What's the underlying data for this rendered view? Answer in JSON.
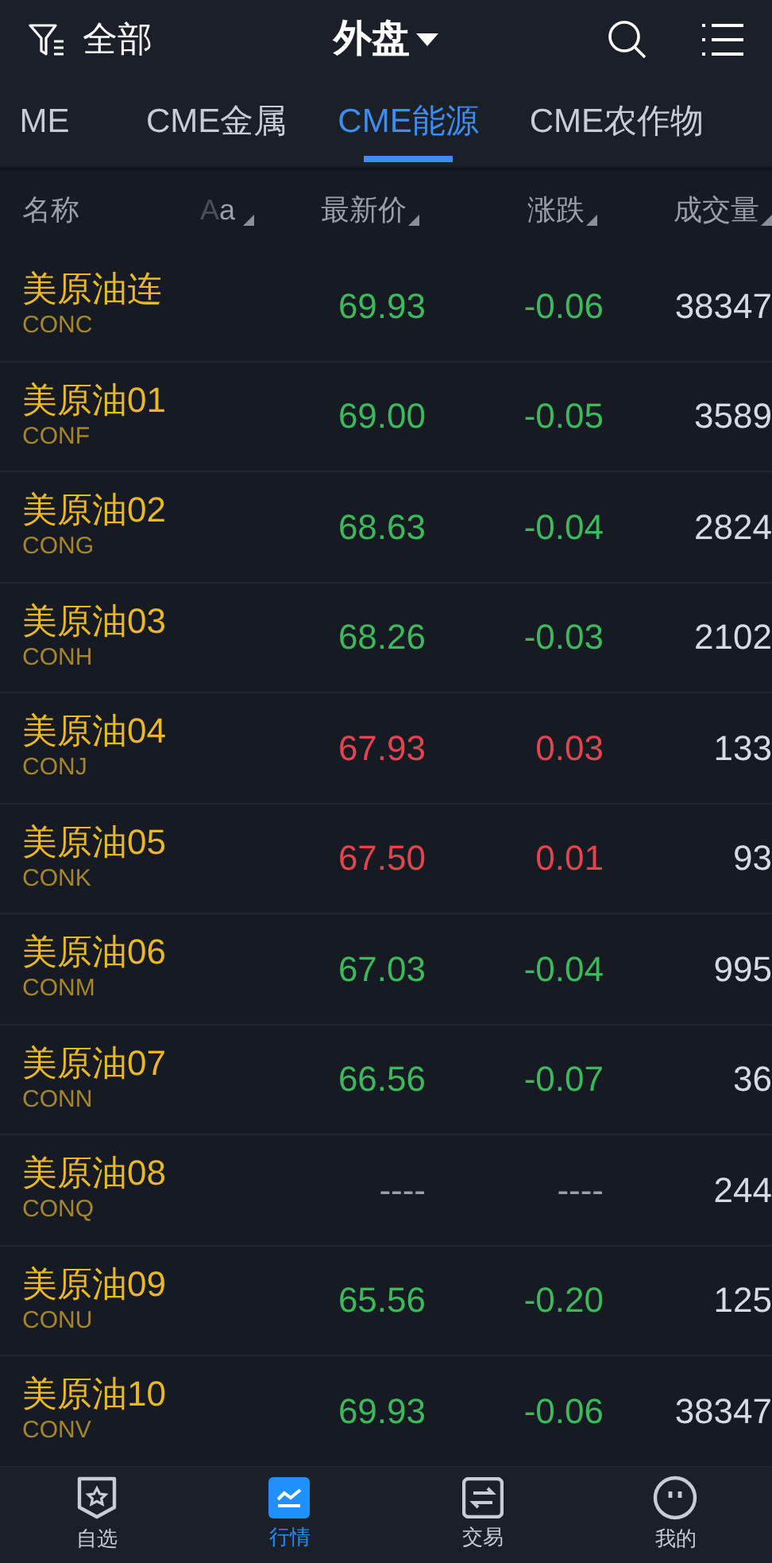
{
  "top_bar": {
    "filter_label": "全部",
    "title": "外盘"
  },
  "tabs": [
    {
      "label": "ME",
      "selected": false
    },
    {
      "label": "CME金属",
      "selected": false
    },
    {
      "label": "CME能源",
      "selected": true
    },
    {
      "label": "CME农作物",
      "selected": false
    }
  ],
  "columns": {
    "name": "名称",
    "font_toggle": "Aa",
    "price": "最新价",
    "change": "涨跌",
    "volume": "成交量"
  },
  "rows": [
    {
      "name": "美原油连",
      "code": "CONC",
      "price": "69.93",
      "change": "-0.06",
      "volume": "38347",
      "kind": "down"
    },
    {
      "name": "美原油01",
      "code": "CONF",
      "price": "69.00",
      "change": "-0.05",
      "volume": "3589",
      "kind": "down"
    },
    {
      "name": "美原油02",
      "code": "CONG",
      "price": "68.63",
      "change": "-0.04",
      "volume": "2824",
      "kind": "down"
    },
    {
      "name": "美原油03",
      "code": "CONH",
      "price": "68.26",
      "change": "-0.03",
      "volume": "2102",
      "kind": "down"
    },
    {
      "name": "美原油04",
      "code": "CONJ",
      "price": "67.93",
      "change": "0.03",
      "volume": "133",
      "kind": "up"
    },
    {
      "name": "美原油05",
      "code": "CONK",
      "price": "67.50",
      "change": "0.01",
      "volume": "93",
      "kind": "up"
    },
    {
      "name": "美原油06",
      "code": "CONM",
      "price": "67.03",
      "change": "-0.04",
      "volume": "995",
      "kind": "down"
    },
    {
      "name": "美原油07",
      "code": "CONN",
      "price": "66.56",
      "change": "-0.07",
      "volume": "36",
      "kind": "down"
    },
    {
      "name": "美原油08",
      "code": "CONQ",
      "price": "----",
      "change": "----",
      "volume": "244",
      "kind": "none"
    },
    {
      "name": "美原油09",
      "code": "CONU",
      "price": "65.56",
      "change": "-0.20",
      "volume": "125",
      "kind": "down"
    },
    {
      "name": "美原油10",
      "code": "CONV",
      "price": "69.93",
      "change": "-0.06",
      "volume": "38347",
      "kind": "down"
    }
  ],
  "bottom_nav": [
    {
      "label": "自选",
      "selected": false,
      "kind": "watchlist"
    },
    {
      "label": "行情",
      "selected": true,
      "kind": "market"
    },
    {
      "label": "交易",
      "selected": false,
      "kind": "trade"
    },
    {
      "label": "我的",
      "selected": false,
      "kind": "profile"
    }
  ]
}
